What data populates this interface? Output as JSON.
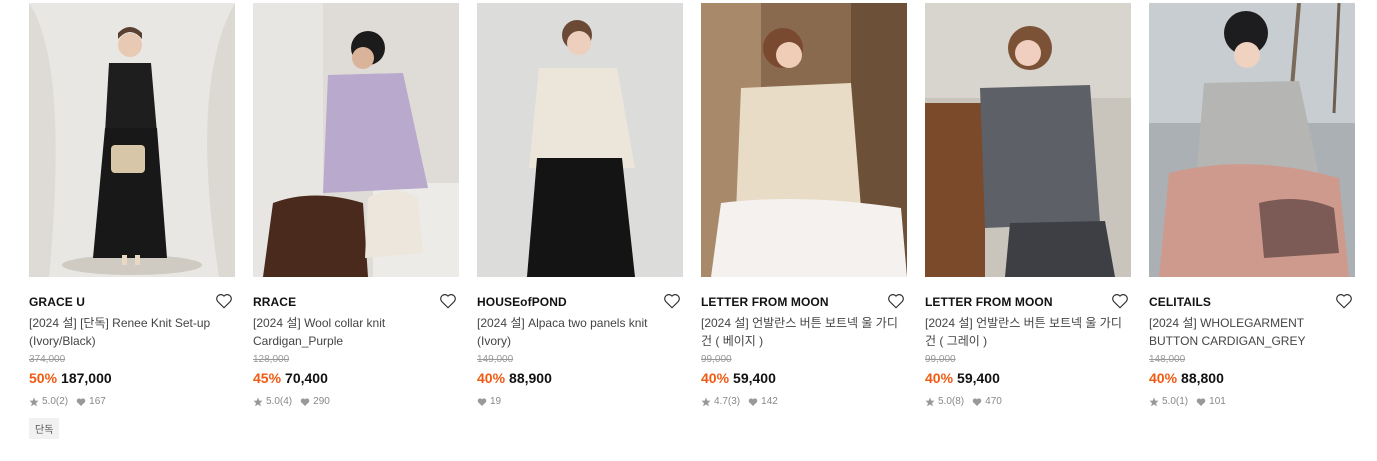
{
  "colors": {
    "discount": "#f05b14",
    "text": "#111111",
    "muted": "#888888"
  },
  "products": [
    {
      "brand": "GRACE U",
      "title": "[2024 설] [단독] Renee Knit Set-up (Ivory/Black)",
      "original_price": "374,000",
      "discount": "50%",
      "price": "187,000",
      "rating": "5.0",
      "reviews": "(2)",
      "likes": "167",
      "tag": "단독",
      "icon": "heart-outline-icon"
    },
    {
      "brand": "RRACE",
      "title": "[2024 설] Wool collar knit Cardigan_Purple",
      "original_price": "128,000",
      "discount": "45%",
      "price": "70,400",
      "rating": "5.0",
      "reviews": "(4)",
      "likes": "290",
      "icon": "heart-outline-icon"
    },
    {
      "brand": "HOUSEofPOND",
      "title": "[2024 설] Alpaca two panels knit (Ivory)",
      "original_price": "149,000",
      "discount": "40%",
      "price": "88,900",
      "likes": "19",
      "icon": "heart-outline-icon"
    },
    {
      "brand": "LETTER FROM MOON",
      "title": "[2024 설] 언발란스 버튼 보트넥 울 가디건 ( 베이지 )",
      "original_price": "99,000",
      "discount": "40%",
      "price": "59,400",
      "rating": "4.7",
      "reviews": "(3)",
      "likes": "142",
      "icon": "heart-outline-icon"
    },
    {
      "brand": "LETTER FROM MOON",
      "title": "[2024 설] 언발란스 버튼 보트넥 울 가디건 ( 그레이 )",
      "original_price": "99,000",
      "discount": "40%",
      "price": "59,400",
      "rating": "5.0",
      "reviews": "(8)",
      "likes": "470",
      "icon": "heart-outline-icon"
    },
    {
      "brand": "CELITAILS",
      "title": "[2024 설] WHOLEGARMENT BUTTON CARDIGAN_GREY",
      "original_price": "148,000",
      "discount": "40%",
      "price": "88,800",
      "rating": "5.0",
      "reviews": "(1)",
      "likes": "101",
      "icon": "heart-outline-icon"
    }
  ]
}
